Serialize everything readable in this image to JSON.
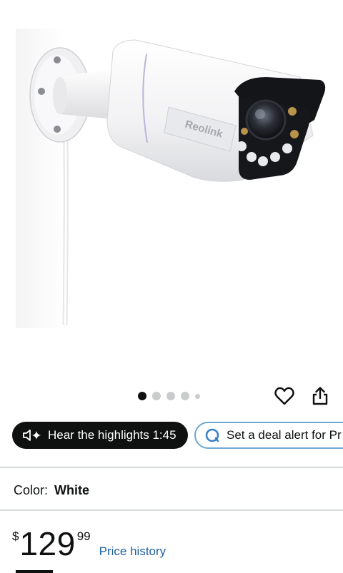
{
  "product": {
    "image_alt": "Reolink white bullet security camera mounted on a wall",
    "brand_mark": "Reolink"
  },
  "carousel": {
    "dot_count": 5,
    "active_index": 0
  },
  "actions": {
    "wishlist_icon": "heart-icon",
    "share_icon": "share-icon"
  },
  "pills": {
    "highlights_label": "Hear the highlights 1:45",
    "highlights_icon": "speaker-sparkle-icon",
    "deal_label": "Set a deal alert for Pr",
    "deal_icon": "alert-icon"
  },
  "color": {
    "label": "Color:",
    "value": "White"
  },
  "price": {
    "symbol": "$",
    "whole": "129",
    "fraction": "99",
    "history_link": "Price history"
  },
  "colors": {
    "primary_text": "#0f1111",
    "link": "#2162a1",
    "pill_dark": "#0f1111",
    "deal_border": "#6fa8d0"
  }
}
